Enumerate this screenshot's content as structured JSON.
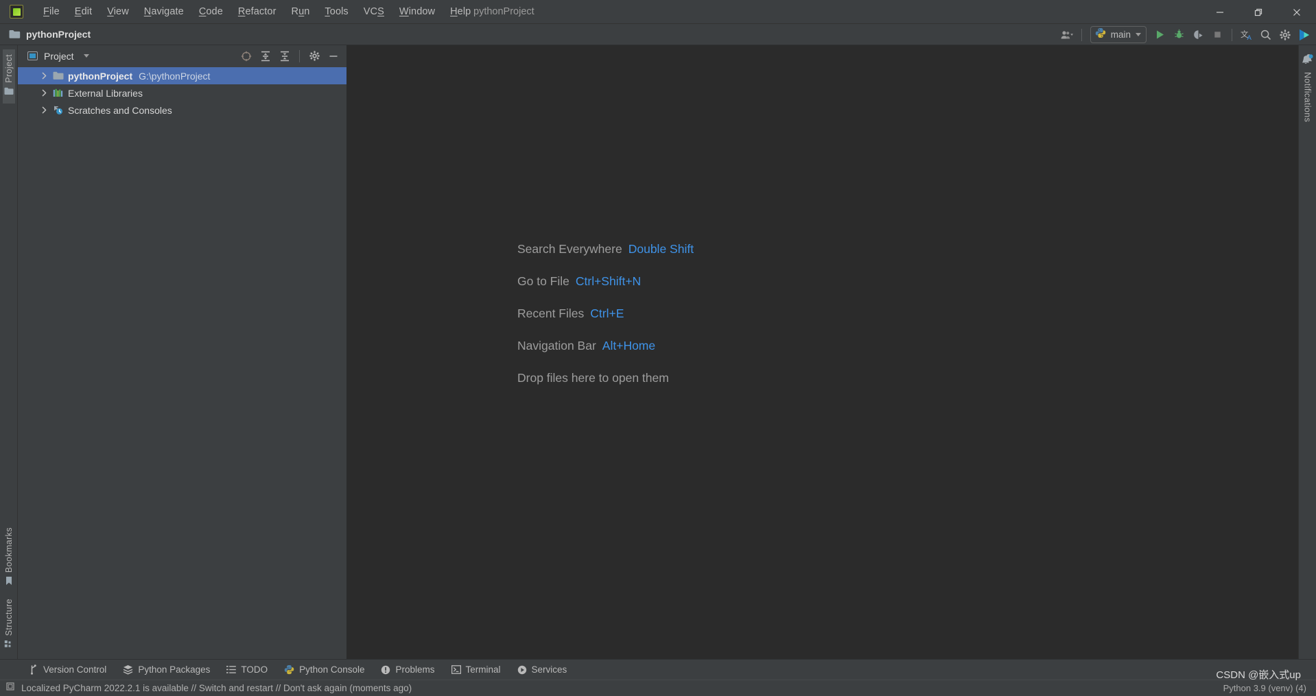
{
  "window": {
    "title": "pythonProject",
    "logo_icon": "pycharm-logo-icon",
    "minimize_icon": "minimize-icon",
    "restore_icon": "restore-icon",
    "close_icon": "close-icon"
  },
  "menubar": {
    "items": [
      {
        "label": "File",
        "mnemonic": "F"
      },
      {
        "label": "Edit",
        "mnemonic": "E"
      },
      {
        "label": "View",
        "mnemonic": "V"
      },
      {
        "label": "Navigate",
        "mnemonic": "N"
      },
      {
        "label": "Code",
        "mnemonic": "C"
      },
      {
        "label": "Refactor",
        "mnemonic": "R"
      },
      {
        "label": "Run",
        "mnemonic": "u"
      },
      {
        "label": "Tools",
        "mnemonic": "T"
      },
      {
        "label": "VCS",
        "mnemonic": "S"
      },
      {
        "label": "Window",
        "mnemonic": "W"
      },
      {
        "label": "Help",
        "mnemonic": "H"
      }
    ]
  },
  "projectbar": {
    "project_name": "pythonProject",
    "folder_icon": "folder-icon",
    "account_icon": "account-icon",
    "run_config": {
      "label": "main",
      "icon": "python-icon",
      "dropdown_icon": "chevron-down-icon"
    },
    "actions": [
      {
        "name": "run-button",
        "icon": "run-triangle-icon",
        "color": "#59a869"
      },
      {
        "name": "debug-button",
        "icon": "debug-bug-icon",
        "color": "#59a869"
      },
      {
        "name": "run-with-coverage-button",
        "icon": "coverage-icon",
        "color": "#9aa0a6"
      },
      {
        "name": "stop-button",
        "icon": "stop-square-icon",
        "color": "#7a7a7a"
      },
      {
        "name": "translate-button",
        "icon": "translate-icon",
        "color": "#b0b0b0"
      },
      {
        "name": "search-button",
        "icon": "search-icon",
        "color": "#b0b0b0"
      },
      {
        "name": "settings-button",
        "icon": "gear-icon",
        "color": "#b0b0b0"
      },
      {
        "name": "ide-assistant-button",
        "icon": "play-badge-icon",
        "color": "#3ba2d6"
      }
    ]
  },
  "left_rail": {
    "top": [
      {
        "label": "Project",
        "icon": "folder-icon",
        "active": true
      }
    ],
    "bottom": [
      {
        "label": "Bookmarks",
        "icon": "bookmark-icon",
        "active": false
      },
      {
        "label": "Structure",
        "icon": "structure-icon",
        "active": false
      }
    ]
  },
  "right_rail": {
    "items": [
      {
        "label": "Notifications",
        "icon": "bell-icon",
        "badge": true
      }
    ]
  },
  "tool_window": {
    "title": "Project",
    "view_icon": "project-view-icon",
    "dropdown_icon": "chevron-down-icon",
    "actions": [
      {
        "name": "select-opened-file-button",
        "icon": "target-icon"
      },
      {
        "name": "expand-all-button",
        "icon": "expand-all-icon"
      },
      {
        "name": "collapse-all-button",
        "icon": "collapse-all-icon"
      },
      {
        "name": "tool-window-options-button",
        "icon": "gear-icon"
      },
      {
        "name": "hide-tool-window-button",
        "icon": "minimize-icon"
      }
    ],
    "tree": [
      {
        "label": "pythonProject",
        "sublabel": "G:\\pythonProject",
        "icon": "folder-icon",
        "arrow": "chevron-right-icon",
        "selected": true,
        "bold": true
      },
      {
        "label": "External Libraries",
        "sublabel": "",
        "icon": "libraries-icon",
        "arrow": "chevron-right-icon",
        "selected": false,
        "bold": false
      },
      {
        "label": "Scratches and Consoles",
        "sublabel": "",
        "icon": "scratches-icon",
        "arrow": "chevron-right-icon",
        "selected": false,
        "bold": false
      }
    ]
  },
  "editor": {
    "tips": [
      {
        "action": "Search Everywhere",
        "shortcut": "Double Shift"
      },
      {
        "action": "Go to File",
        "shortcut": "Ctrl+Shift+N"
      },
      {
        "action": "Recent Files",
        "shortcut": "Ctrl+E"
      },
      {
        "action": "Navigation Bar",
        "shortcut": "Alt+Home"
      },
      {
        "action": "Drop files here to open them",
        "shortcut": ""
      }
    ]
  },
  "bottom_bar": {
    "items": [
      {
        "label": "Version Control",
        "icon": "branch-icon"
      },
      {
        "label": "Python Packages",
        "icon": "packages-icon"
      },
      {
        "label": "TODO",
        "icon": "todo-list-icon"
      },
      {
        "label": "Python Console",
        "icon": "python-icon"
      },
      {
        "label": "Problems",
        "icon": "problems-icon"
      },
      {
        "label": "Terminal",
        "icon": "terminal-icon"
      },
      {
        "label": "Services",
        "icon": "services-icon"
      }
    ]
  },
  "status_bar": {
    "icon": "memory-indicator-icon",
    "message": "Localized PyCharm 2022.2.1 is available // Switch and restart // Don't ask again (moments ago)",
    "interpreter": "Python 3.9 (venv) (4)"
  },
  "watermark": {
    "text": "CSDN @嵌入式up"
  },
  "colors": {
    "panel_bg": "#3c3f41",
    "editor_bg": "#2b2b2b",
    "selection_blue": "#4b6eaf",
    "link_blue": "#3f93e8",
    "accent_green": "#59a869",
    "text_primary": "#d6d6d6",
    "text_secondary": "#a4a4a4"
  }
}
